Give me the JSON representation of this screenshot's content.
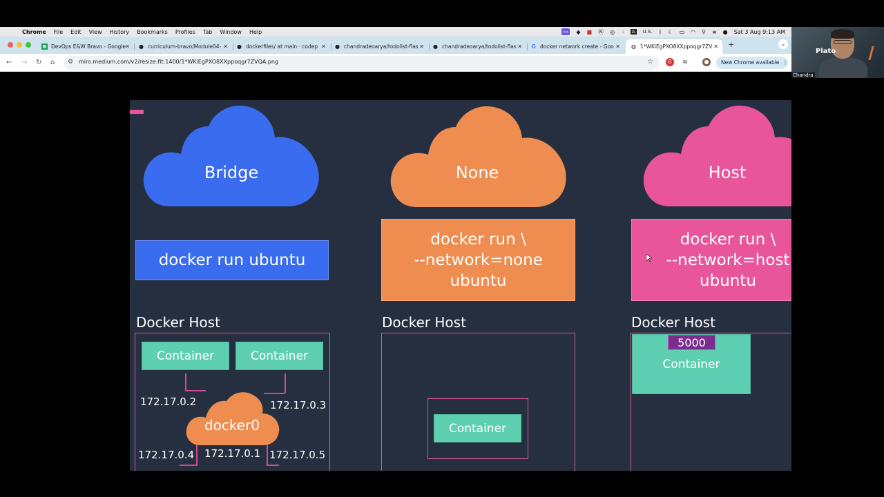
{
  "menubar": {
    "items": [
      "Chrome",
      "File",
      "Edit",
      "View",
      "History",
      "Bookmarks",
      "Profiles",
      "Tab",
      "Window",
      "Help"
    ],
    "input_source": "U.S.",
    "clock": "Sat 3 Aug  9:13 AM"
  },
  "tabs": [
    {
      "title": "DevOps E&W Bravo - Google",
      "icon": "sheets-icon"
    },
    {
      "title": "curriculum-bravo/Module04-",
      "icon": "github-icon"
    },
    {
      "title": "dockerfiles/ at main · codep",
      "icon": "github-icon"
    },
    {
      "title": "chandradeoarya/todolist-flas",
      "icon": "github-icon"
    },
    {
      "title": "chandradeoarya/todolist-flas",
      "icon": "github-icon"
    },
    {
      "title": "docker network create - Goo",
      "icon": "google-icon"
    },
    {
      "title": "1*WKiEgPXO8XXppoqgr7ZV",
      "icon": "globe-icon"
    }
  ],
  "toolbar": {
    "url": "miro.medium.com/v2/resize:fit:1400/1*WKiEgPXO8XXppoqgr7ZVQA.png",
    "update_label": "New Chrome available"
  },
  "webcam": {
    "name": "Chandra",
    "logo": "Plato"
  },
  "slide": {
    "colors": {
      "background": "#262f3f",
      "bridge": "#3a6cf0",
      "none": "#ef8c50",
      "host": "#e8559a",
      "container": "#5ecfb0"
    },
    "bridge": {
      "cloud_label": "Bridge",
      "command": "docker run ubuntu",
      "host_label": "Docker Host",
      "container_1": "Container",
      "container_2": "Container",
      "bridge_label": "docker0",
      "ips": [
        "172.17.0.2",
        "172.17.0.3",
        "172.17.0.4",
        "172.17.0.1",
        "172.17.0.5"
      ]
    },
    "none": {
      "cloud_label": "None",
      "command": "docker run \\\n--network=none\nubuntu",
      "host_label": "Docker Host",
      "container": "Container"
    },
    "host": {
      "cloud_label": "Host",
      "command": "docker run \\\n--network=host\nubuntu",
      "host_label": "Docker Host",
      "port": "5000",
      "container": "Container"
    }
  }
}
